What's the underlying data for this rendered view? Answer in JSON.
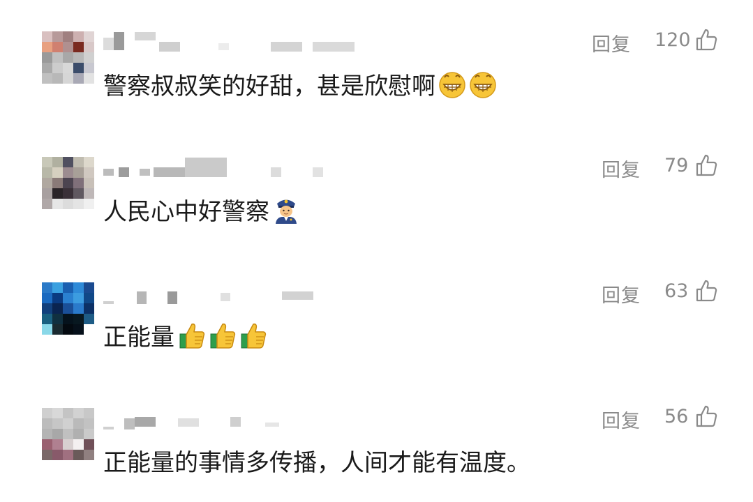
{
  "comments": [
    {
      "reply_label": "回复",
      "likes": "120",
      "text": "警察叔叔笑的好甜，甚是欣慰啊",
      "emojis": [
        "grin-icon",
        "grin-icon"
      ]
    },
    {
      "reply_label": "回复",
      "likes": "79",
      "text": "人民心中好警察",
      "emojis": [
        "police-officer-icon"
      ]
    },
    {
      "reply_label": "回复",
      "likes": "63",
      "text": "正能量",
      "emojis": [
        "thumbs-up-icon",
        "thumbs-up-icon",
        "thumbs-up-icon"
      ]
    },
    {
      "reply_label": "回复",
      "likes": "56",
      "text": "正能量的事情多传播，人间才能有温度。",
      "emojis": []
    }
  ],
  "colors": {
    "meta_gray": "#8a8a8a",
    "text": "#1a1a1a",
    "emoji_yellow": "#f7c538",
    "thumb_green": "#2e9e4c"
  }
}
